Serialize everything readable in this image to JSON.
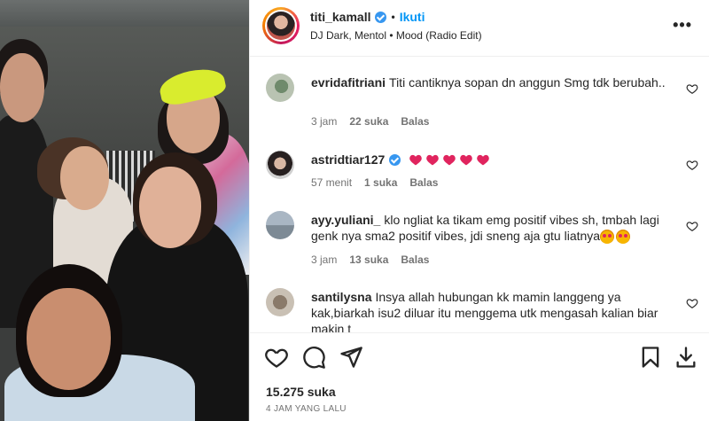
{
  "header": {
    "username": "titi_kamall",
    "separator": "•",
    "follow_label": "Ikuti",
    "song": "DJ Dark, Mentol • Mood (Radio Edit)",
    "more_label": "•••"
  },
  "comments": [
    {
      "username": "evridafitriani",
      "text": "Titi cantiknya sopan dn anggun Smg tdk berubah..",
      "time": "3 jam",
      "likes": "22 suka",
      "reply": "Balas"
    },
    {
      "username": "astridtiar127",
      "text": "",
      "verified": true,
      "hearts": 5,
      "time": "57 menit",
      "likes": "1 suka",
      "reply": "Balas"
    },
    {
      "username": "ayy.yuliani_",
      "text": "klo ngliat ka tikam emg positif vibes sh, tmbah lagi genk nya sma2 positif vibes, jdi sneng aja gtu liatnya",
      "time": "3 jam",
      "likes": "13 suka",
      "reply": "Balas"
    },
    {
      "username": "santilysna",
      "text": "Insya allah hubungan kk mamin langgeng ya kak,biarkah isu2 diluar itu menggema utk mengasah kalian biar makin t",
      "time": "",
      "likes": "",
      "reply": ""
    }
  ],
  "footer": {
    "likes": "15.275 suka",
    "time_ago": "4 JAM YANG LALU"
  },
  "colors": {
    "accent_blue": "#0095f6",
    "verified_blue": "#3797f0",
    "heart_red": "#e0245e",
    "muted_text": "#737373"
  }
}
